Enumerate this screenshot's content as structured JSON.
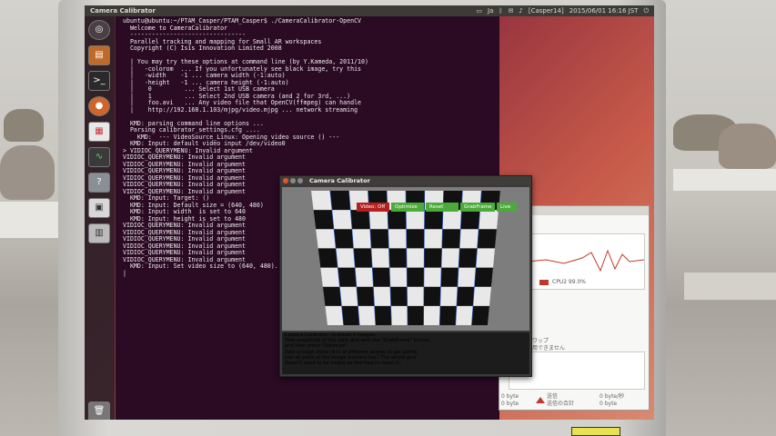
{
  "colors": {
    "terminal_bg": "#2b0a24",
    "terminal_fg": "#ececec",
    "panel_bg": "#3c3b37",
    "cpu_red": "#c0392b",
    "btn_red": "#b42020",
    "btn_green": "#4caa3a",
    "message_yellow": "#f0e060"
  },
  "top_panel": {
    "app_title": "Camera Calibrator",
    "user_badge": "[Casper14]",
    "datetime": "2015/06/01 16:16 JST",
    "ime": "Ja"
  },
  "launcher": {
    "icons": [
      "ubuntu-dash-icon",
      "files-icon",
      "terminal-icon",
      "firefox-icon",
      "libreoffice-icon",
      "system-monitor-icon",
      "help-icon",
      "software-icon",
      "workspace-icon",
      "trash-icon"
    ]
  },
  "terminal": {
    "lines": [
      "ubuntu@ubuntu:~/PTAM_Casper/PTAM_Casper$ ./CameraCalibrator-OpenCV",
      "  Welcome to CameraCalibrator",
      "  --------------------------------",
      "  Parallel tracking and mapping for Small AR workspaces",
      "  Copyright (C) Isis Innovation Limited 2008",
      "",
      "  | You may try these options at command line (by Y.Kameda, 2011/10)",
      "  |   -colorom  ... If you unfortunately see black image, try this",
      "  |   -width    -1 ... camera width (-1:auto)",
      "  |   -height   -1 ... camera height (-1:auto)",
      "  |    0         ... Select 1st USB camera",
      "  |    1         ... Select 2nd USB camera (and 2 for 3rd, ...)",
      "  |    foo.avi   ... Any video file that OpenCV(ffmpeg) can handle",
      "  |    http://192.168.1.103/mjpg/video.mjpg ... network streaming",
      "",
      "  KMD: parsing command line options ...",
      "  Parsing calibrator_settings.cfg ....",
      "    KMD:  --- VideoSource_Linux: Opening video source () ---",
      "  KMD: Input: default video input /dev/video0",
      "> VIDIOC_QUERYMENU: Invalid argument",
      "VIDIOC_QUERYMENU: Invalid argument",
      "VIDIOC_QUERYMENU: Invalid argument",
      "VIDIOC_QUERYMENU: Invalid argument",
      "VIDIOC_QUERYMENU: Invalid argument",
      "VIDIOC_QUERYMENU: Invalid argument",
      "VIDIOC_QUERYMENU: Invalid argument",
      "  KMD: Input: Target: ()",
      "  KMD: Input: Default size = (640, 480)",
      "  KMD: Input: width  is set to 640",
      "  KMD: Input: height is set to 480",
      "VIDIOC_QUERYMENU: Invalid argument",
      "VIDIOC_QUERYMENU: Invalid argument",
      "VIDIOC_QUERYMENU: Invalid argument",
      "VIDIOC_QUERYMENU: Invalid argument",
      "VIDIOC_QUERYMENU: Invalid argument",
      "VIDIOC_QUERYMENU: Invalid argument",
      "  KMD: Input: Set video size to (640, 480).",
      "|"
    ]
  },
  "system_monitor": {
    "cpu_legend": "CPU2 99.0%",
    "swap_label": "スワップ",
    "swap_value": "利用できません",
    "net_recv_label": "送信",
    "net_recv_total": "送信の合計",
    "net_recv_value": "0 byte/秒",
    "net_recv_bytes": "0 byte",
    "net_left_value": "0 byte",
    "net_left_bytes": "0 byte"
  },
  "calibrator": {
    "window_title": "Camera Calibrator",
    "buttons": {
      "video_off": "Video: Off",
      "optimize": "Optimize",
      "reset": "Reset",
      "grab_frame": "GrabFrame",
      "live": "Live"
    },
    "messages": [
      "Camera Calibrator: Grabbed 2 images.",
      "Take snapshots of the calib grid with the \"GrabFrame\" button,",
      "and then press \"Optimize\".",
      "Take enough shots (4+) at different angles to get points",
      "into all parts of the image (corners too.) The whole grid",
      "doesn't need to be visible so feel free to zoom in."
    ]
  }
}
